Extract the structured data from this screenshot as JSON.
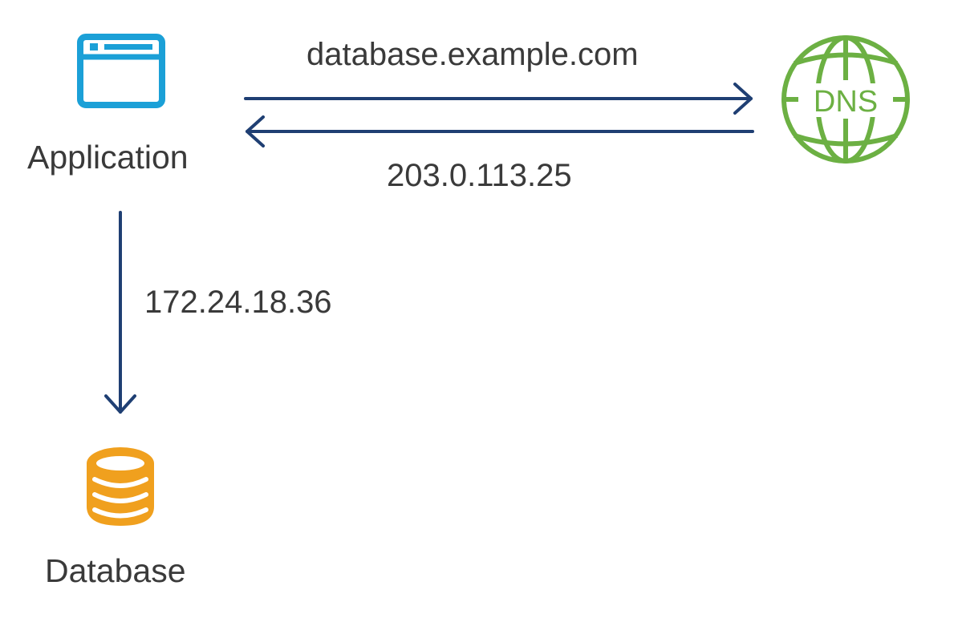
{
  "nodes": {
    "application": {
      "label": "Application",
      "icon": "browser-window-icon",
      "color": "#1ba0d7"
    },
    "dns": {
      "label": "DNS",
      "icon": "globe-icon",
      "color": "#6cb043"
    },
    "database": {
      "label": "Database",
      "icon": "database-icon",
      "color": "#f0a01e"
    }
  },
  "edges": {
    "query": {
      "label": "database.example.com",
      "from": "Application",
      "to": "DNS"
    },
    "answer": {
      "label": "203.0.113.25",
      "from": "DNS",
      "to": "Application"
    },
    "connect": {
      "label": "172.24.18.36",
      "from": "Application",
      "to": "Database"
    }
  },
  "arrow_color": "#1f3f73",
  "text_color": "#3a3a3a"
}
